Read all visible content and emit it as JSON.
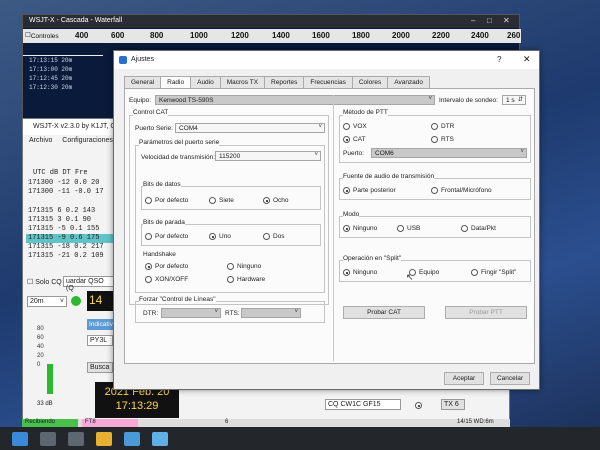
{
  "waterfall": {
    "title": "WSJT-X - Cascada - Waterfall",
    "controls_label": "Controles",
    "scale": [
      "400",
      "600",
      "800",
      "1000",
      "1200",
      "1400",
      "1600",
      "1800",
      "2000",
      "2200",
      "2400",
      "260"
    ],
    "rows": [
      "17:13:15  20m",
      "17:13:00  20m",
      "17:12:45  20m",
      "17:12:30  20m"
    ]
  },
  "main": {
    "title": "WSJT-X   v2.3.0   by K1JT, G",
    "menu": [
      "Archivo",
      "Configuraciones",
      "Ve"
    ],
    "header": "UTC   dB   DT  Fre",
    "rows": [
      {
        "text": "171300 -12  0.0  20",
        "hl": false
      },
      {
        "text": "171300 -11 -0.0  17",
        "hl": false
      },
      {
        "text": "171315   6  0.2 143",
        "hl": false
      },
      {
        "text": "171315   3  0.1  90",
        "hl": false
      },
      {
        "text": "171315  -5  0.1 155",
        "hl": false
      },
      {
        "text": "171315  -9  0.6 175",
        "hl": true
      },
      {
        "text": "171315 -18  0.2 217",
        "hl": false
      },
      {
        "text": "171315 -21  0.2 109",
        "hl": false
      }
    ],
    "solo_cq": "Solo CQ",
    "guardar_qso": "uardar QSO (Q",
    "band": "20m",
    "freq_partial": "14",
    "indicativo": "Indicativ",
    "call_partial": "PY3L",
    "buscar": "Busca",
    "db_label": "33 dB",
    "meter_scale": [
      "80",
      "60",
      "40",
      "20",
      "0"
    ],
    "clock_date": "2021 Feb. 20",
    "clock_time": "17:13:29",
    "tx_message": "CQ CW1C GF15",
    "tx_slot": "TX 6",
    "status": {
      "recibiendo": "Recibiendo",
      "ft8": "FT8",
      "num": "6",
      "right": "14/15  WD:6m"
    }
  },
  "dialog": {
    "title": "Ajustes",
    "help": "?",
    "close": "✕",
    "tabs": [
      "General",
      "Radio",
      "Audio",
      "Macros TX",
      "Reportes",
      "Frecuencias",
      "Colores",
      "Avanzado"
    ],
    "active_tab": "Radio",
    "equipo_label": "Equipo:",
    "equipo_value": "Kenwood TS-590S",
    "intervalo_label": "Intervalo de sondeo:",
    "intervalo_value": "1 s",
    "control_cat": {
      "title": "Control CAT",
      "puerto_label": "Puerto Serie:",
      "puerto_value": "COM4",
      "params_title": "Parámetros del puerto serie",
      "velocidad_label": "Velocidad de transmisión:",
      "velocidad_value": "115200",
      "bits_datos_title": "Bits de datos",
      "bits_datos": [
        "Por defecto",
        "Siete",
        "Ocho"
      ],
      "bits_datos_selected": 2,
      "bits_parada_title": "Bits de parada",
      "bits_parada": [
        "Por defecto",
        "Uno",
        "Dos"
      ],
      "bits_parada_selected": 1,
      "handshake_title": "Handshake",
      "handshake": [
        "Por defecto",
        "Ninguno",
        "XON/XOFF",
        "Hardware"
      ],
      "handshake_selected": 0,
      "forzar_title": "Forzar \"Control de Líneas\"",
      "dtr_label": "DTR:",
      "rts_label": "RTS:"
    },
    "ptt": {
      "title": "Método de PTT",
      "options": [
        "VOX",
        "DTR",
        "CAT",
        "RTS"
      ],
      "selected": "CAT",
      "puerto_label": "Puerto:",
      "puerto_value": "COM6"
    },
    "audio_source": {
      "title": "Fuente de audio de transmisión",
      "options": [
        "Parte posterior",
        "Frontal/Micrófono"
      ],
      "selected": 0
    },
    "modo": {
      "title": "Modo",
      "options": [
        "Ninguno",
        "USB",
        "Data/Pkt"
      ],
      "selected": 0
    },
    "split": {
      "title": "Operación en \"Split\"",
      "options": [
        "Ninguno",
        "Equipo",
        "Fingir \"Split\""
      ],
      "selected": 0
    },
    "probar_cat": "Probar CAT",
    "probar_ptt": "Probar PTT",
    "aceptar": "Aceptar",
    "cancelar": "Cancelar"
  }
}
